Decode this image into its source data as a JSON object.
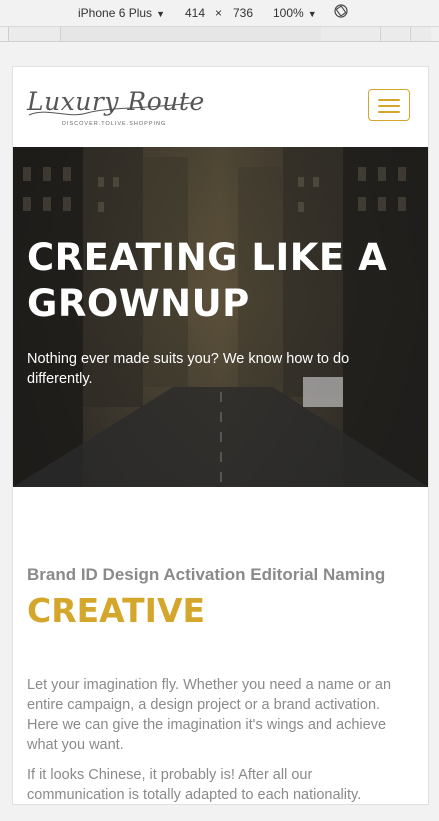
{
  "devtools": {
    "device": "iPhone 6 Plus",
    "width": "414",
    "times": "×",
    "height": "736",
    "zoom": "100%",
    "dropdown_glyph": "▼"
  },
  "site": {
    "logo": {
      "name": "Luxury Route",
      "tagline": "DISCOVER.TOLIVE.SHOPPING"
    },
    "menu_icon": "hamburger-icon",
    "accent_color": "#d4a72c"
  },
  "hero": {
    "title": "CREATING LIKE A GROWNUP",
    "subtitle": "Nothing ever made suits you? We know how to do differently."
  },
  "section": {
    "services": "Brand ID Design Activation Editorial Naming",
    "title": "CREATIVE",
    "paragraphs": [
      "Let your imagination fly. Whether you need a name or an entire campaign, a design project or a brand activation. Here we can give the imagination it's wings and achieve what you want.",
      "If it looks Chinese, it probably is! After all our communication is totally adapted to each nationality."
    ]
  }
}
